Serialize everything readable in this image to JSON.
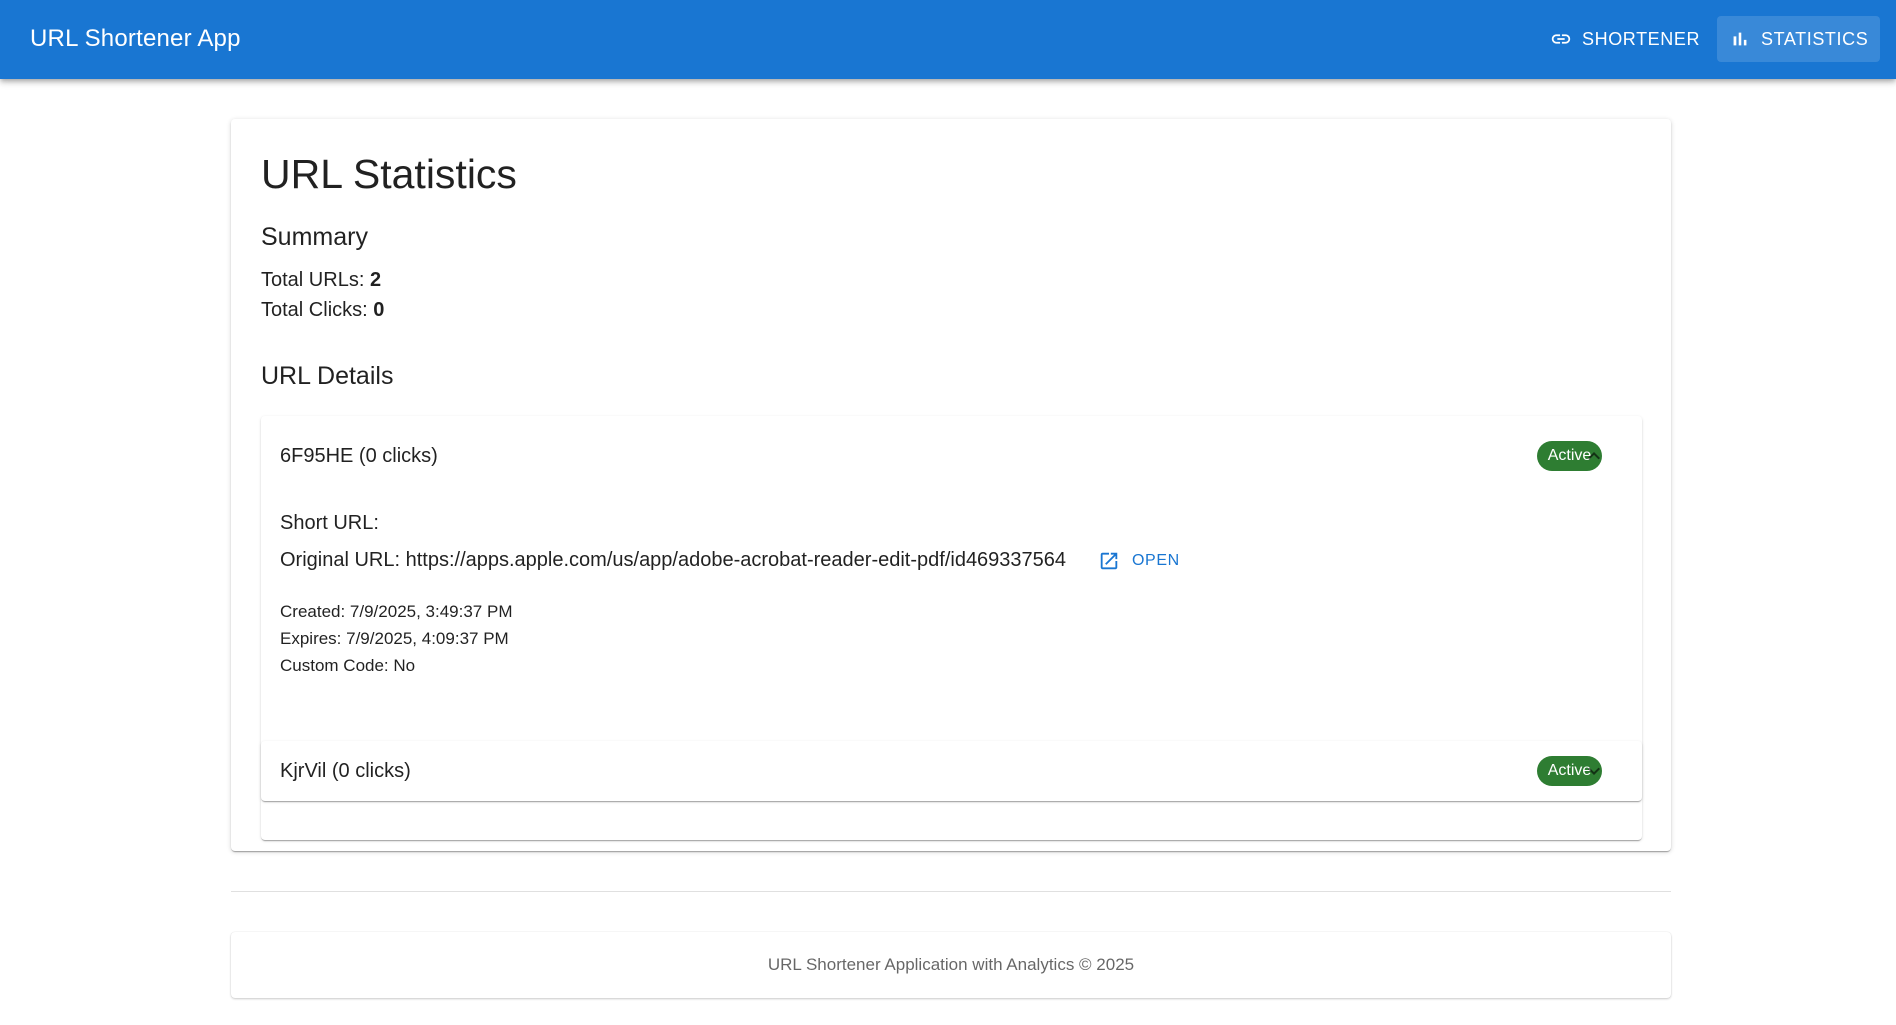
{
  "app": {
    "title": "URL Shortener App",
    "nav": [
      {
        "label": "SHORTENER",
        "icon": "link-icon"
      },
      {
        "label": "STATISTICS",
        "icon": "bar-chart-icon",
        "active": true
      }
    ]
  },
  "page": {
    "title": "URL Statistics",
    "summary": {
      "heading": "Summary",
      "total_urls_label": "Total URLs:",
      "total_urls": "2",
      "total_clicks_label": "Total Clicks:",
      "total_clicks": "0"
    },
    "details_heading": "URL Details",
    "urls": [
      {
        "header": "6F95HE (0 clicks)",
        "status": "Active",
        "expanded": true,
        "short_url_label": "Short URL:",
        "original_url_line": "Original URL: https://apps.apple.com/us/app/adobe-acrobat-reader-edit-pdf/id469337564",
        "open_label": "OPEN",
        "created": "Created: 7/9/2025, 3:49:37 PM",
        "expires": "Expires: 7/9/2025, 4:09:37 PM",
        "custom_code": "Custom Code: No"
      },
      {
        "header": "KjrVil (0 clicks)",
        "status": "Active",
        "expanded": false
      }
    ]
  },
  "footer": {
    "text": "URL Shortener Application with Analytics © 2025"
  },
  "colors": {
    "primary": "#1976d2",
    "status_active": "#2e7d32"
  }
}
